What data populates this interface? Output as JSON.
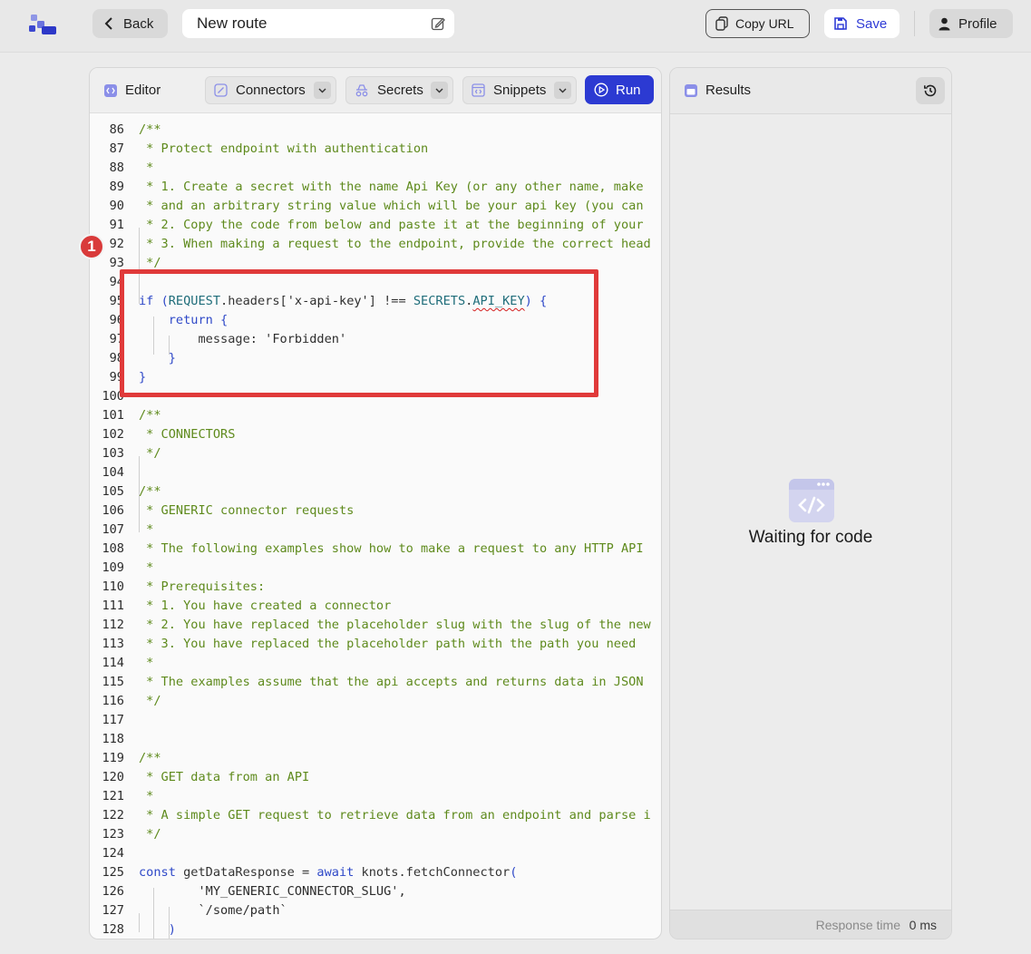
{
  "header": {
    "back_label": "Back",
    "route_title": "New route",
    "copy_url_label": "Copy URL",
    "save_label": "Save",
    "profile_label": "Profile"
  },
  "editor": {
    "title": "Editor",
    "dropdowns": [
      "Connectors",
      "Secrets",
      "Snippets"
    ],
    "run_label": "Run"
  },
  "code_lines": [
    {
      "n": "86",
      "t": "/**",
      "k": "com"
    },
    {
      "n": "87",
      "t": " * Protect endpoint with authentication",
      "k": "com"
    },
    {
      "n": "88",
      "t": " *",
      "k": "com"
    },
    {
      "n": "89",
      "t": " * 1. Create a secret with the name Api Key (or any other name, make",
      "k": "com"
    },
    {
      "n": "90",
      "t": " * and an arbitrary string value which will be your api key (you can",
      "k": "com"
    },
    {
      "n": "91",
      "t": " * 2. Copy the code from below and paste it at the beginning of your",
      "k": "com"
    },
    {
      "n": "92",
      "t": " * 3. When making a request to the endpoint, provide the correct head",
      "k": "com"
    },
    {
      "n": "93",
      "t": " */",
      "k": "com"
    },
    {
      "n": "94",
      "t": "",
      "k": "code"
    },
    {
      "n": "95",
      "t": "if (REQUEST.headers['x-api-key'] !== SECRETS.API_KEY) {",
      "k": "if"
    },
    {
      "n": "96",
      "t": "    return {",
      "k": "ret"
    },
    {
      "n": "97",
      "t": "        message: 'Forbidden'",
      "k": "msg"
    },
    {
      "n": "98",
      "t": "    }",
      "k": "kwb"
    },
    {
      "n": "99",
      "t": "}",
      "k": "kwb"
    },
    {
      "n": "100",
      "t": "",
      "k": "code"
    },
    {
      "n": "101",
      "t": "/**",
      "k": "com"
    },
    {
      "n": "102",
      "t": " * CONNECTORS",
      "k": "com"
    },
    {
      "n": "103",
      "t": " */",
      "k": "com"
    },
    {
      "n": "104",
      "t": "",
      "k": "code"
    },
    {
      "n": "105",
      "t": "/**",
      "k": "com"
    },
    {
      "n": "106",
      "t": " * GENERIC connector requests",
      "k": "com"
    },
    {
      "n": "107",
      "t": " *",
      "k": "com"
    },
    {
      "n": "108",
      "t": " * The following examples show how to make a request to any HTTP API",
      "k": "com"
    },
    {
      "n": "109",
      "t": " *",
      "k": "com"
    },
    {
      "n": "110",
      "t": " * Prerequisites:",
      "k": "com"
    },
    {
      "n": "111",
      "t": " * 1. You have created a connector",
      "k": "com"
    },
    {
      "n": "112",
      "t": " * 2. You have replaced the placeholder slug with the slug of the new",
      "k": "com"
    },
    {
      "n": "113",
      "t": " * 3. You have replaced the placeholder path with the path you need",
      "k": "com"
    },
    {
      "n": "114",
      "t": " *",
      "k": "com"
    },
    {
      "n": "115",
      "t": " * The examples assume that the api accepts and returns data in JSON",
      "k": "com"
    },
    {
      "n": "116",
      "t": " */",
      "k": "com"
    },
    {
      "n": "117",
      "t": "",
      "k": "code"
    },
    {
      "n": "118",
      "t": "",
      "k": "code"
    },
    {
      "n": "119",
      "t": "/**",
      "k": "com"
    },
    {
      "n": "120",
      "t": " * GET data from an API",
      "k": "com"
    },
    {
      "n": "121",
      "t": " *",
      "k": "com"
    },
    {
      "n": "122",
      "t": " * A simple GET request to retrieve data from an endpoint and parse i",
      "k": "com"
    },
    {
      "n": "123",
      "t": " */",
      "k": "com"
    },
    {
      "n": "124",
      "t": "",
      "k": "code"
    },
    {
      "n": "125",
      "t": "const getDataResponse = await knots.fetchConnector(",
      "k": "const"
    },
    {
      "n": "126",
      "t": "        'MY_GENERIC_CONNECTOR_SLUG',",
      "k": "str"
    },
    {
      "n": "127",
      "t": "        `/some/path`",
      "k": "str"
    },
    {
      "n": "128",
      "t": "    )",
      "k": "kwb"
    }
  ],
  "annotation": {
    "badge_number": "1",
    "highlight_color": "#e03a3a"
  },
  "results": {
    "title": "Results",
    "waiting_text": "Waiting for code",
    "response_time_label": "Response time",
    "response_time_value": "0 ms"
  },
  "colors": {
    "accent": "#2c3ad2",
    "comment": "#5e8a1c",
    "keyword": "#2f49c8"
  }
}
